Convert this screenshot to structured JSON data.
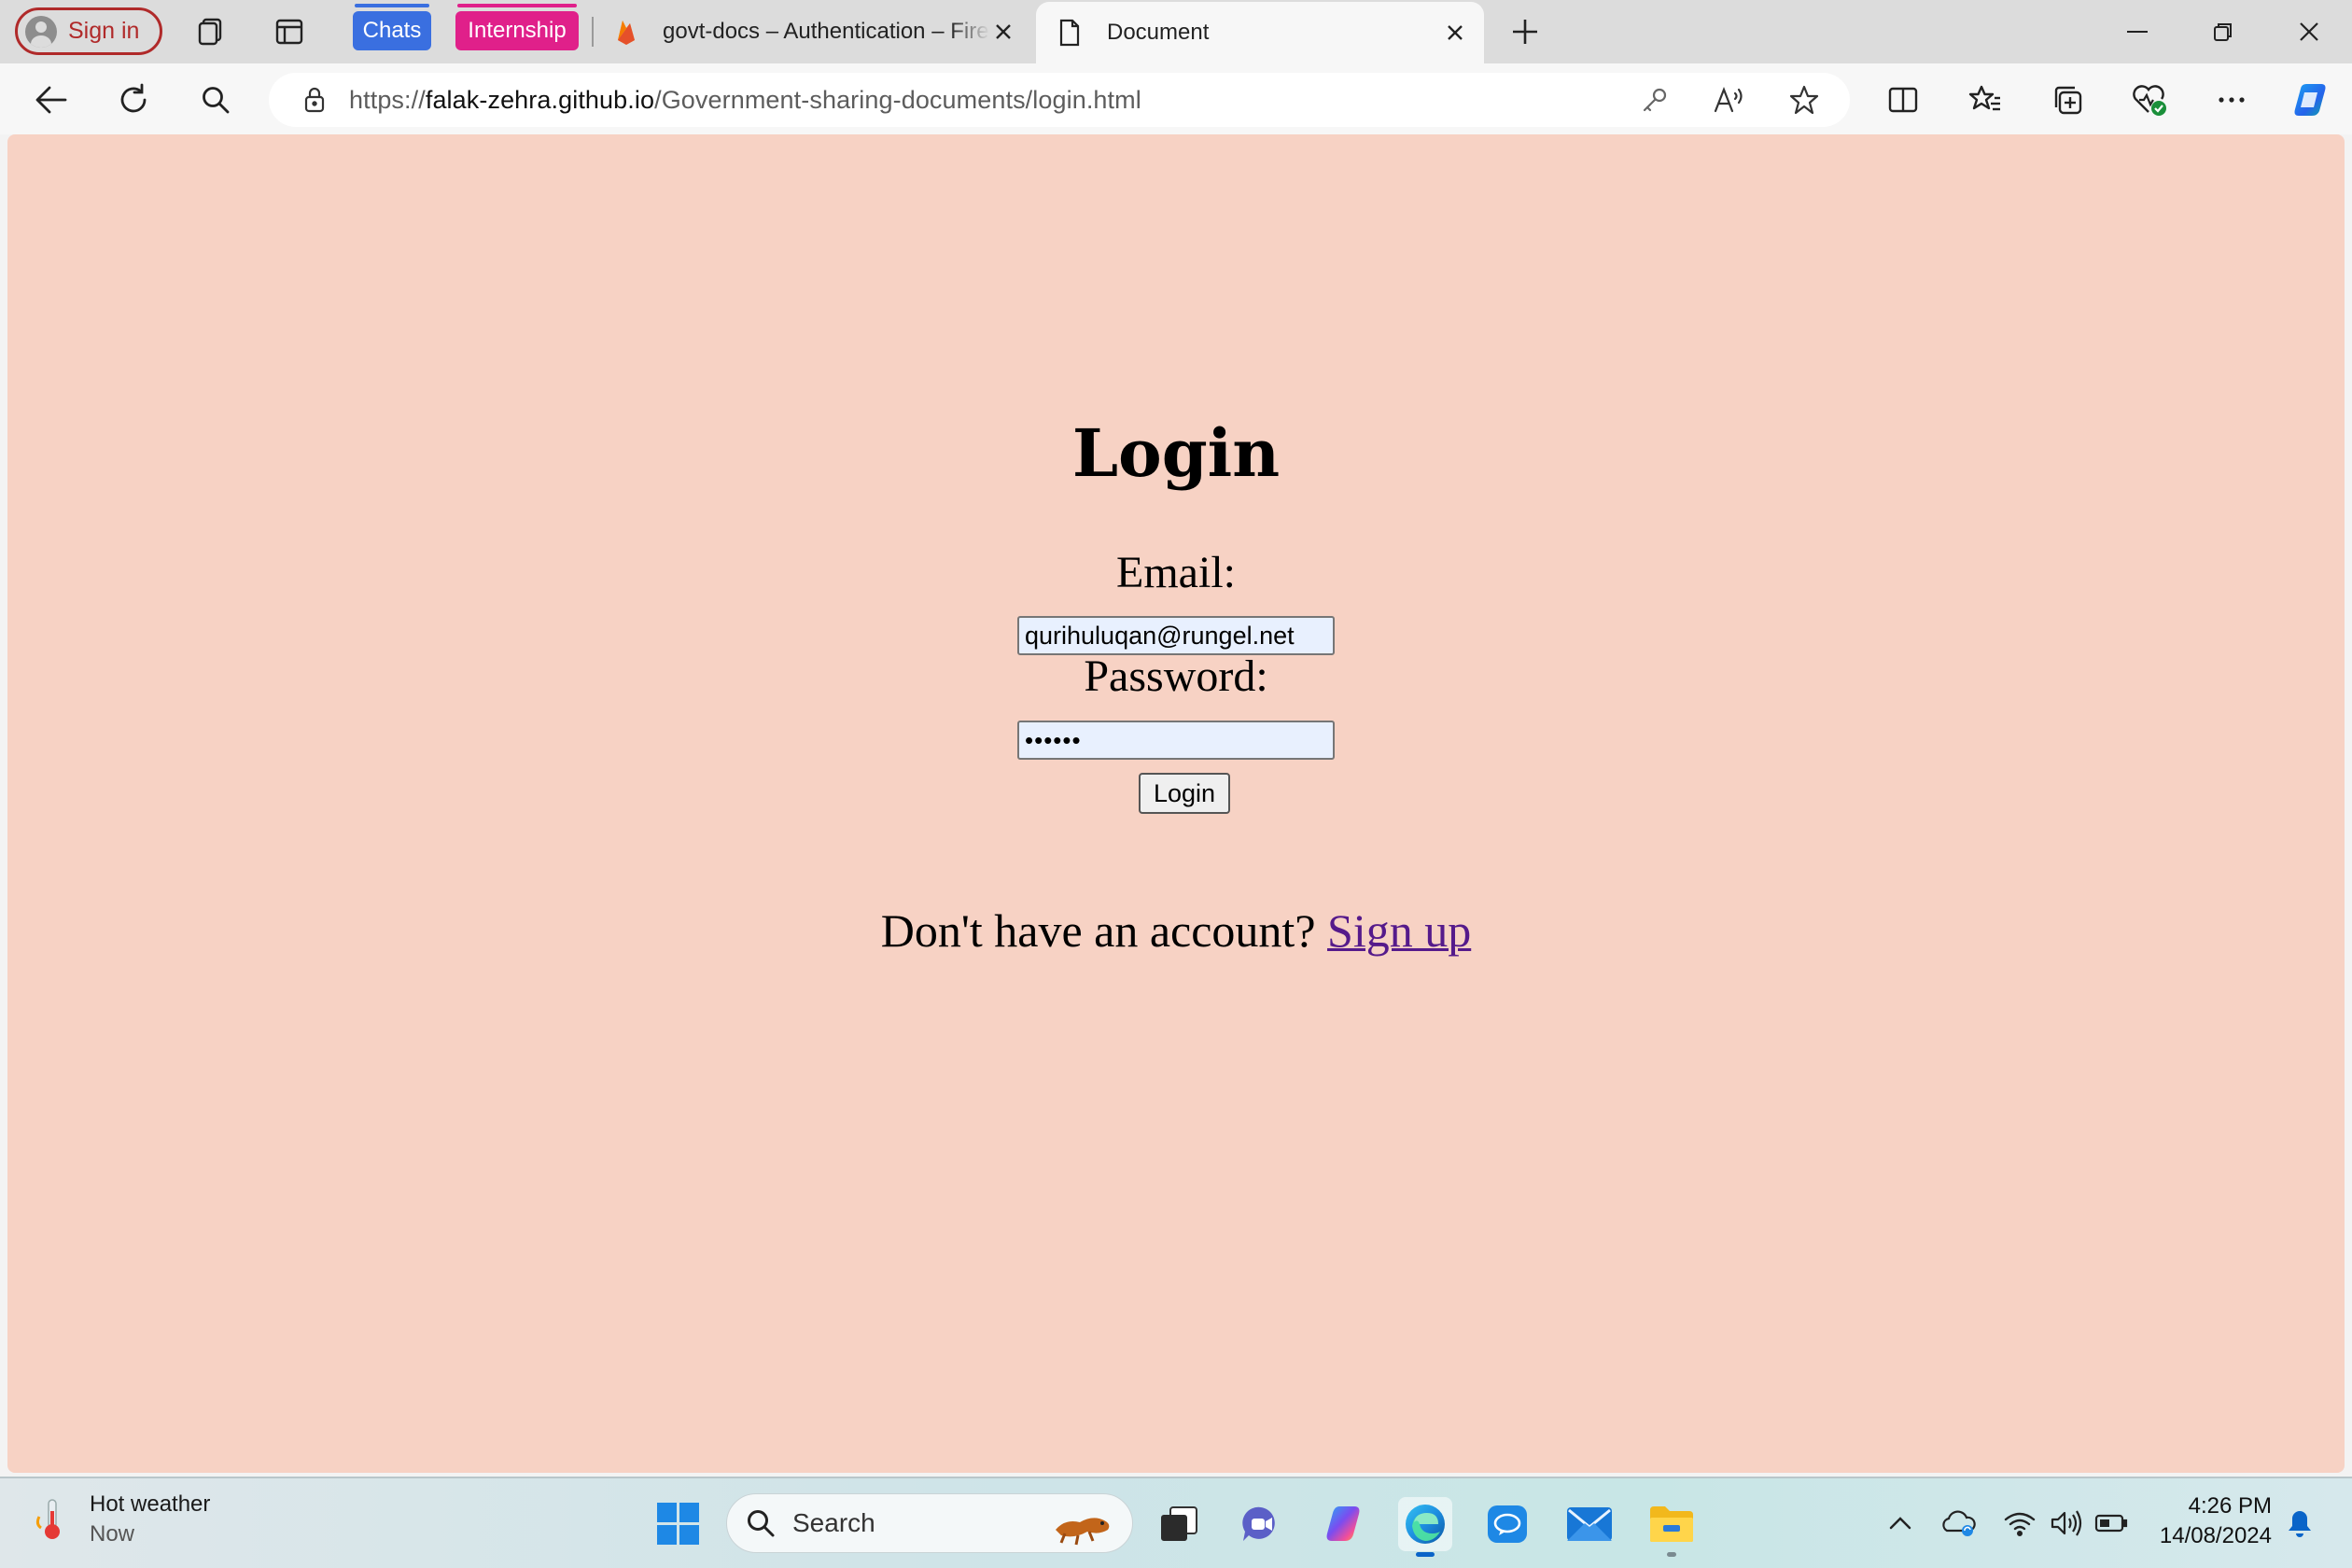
{
  "browser": {
    "profile_button": "Sign in",
    "tab_groups": [
      {
        "label": "Chats",
        "color": "#3a6fe0"
      },
      {
        "label": "Internship",
        "color": "#e0208a"
      }
    ],
    "tabs": [
      {
        "title": "govt-docs – Authentication – Firebase console",
        "icon": "firebase-icon",
        "active": false
      },
      {
        "title": "Document",
        "icon": "document-icon",
        "active": true
      }
    ],
    "url": {
      "scheme": "https://",
      "host": "falak-zehra.github.io",
      "path": "/Government-sharing-documents/login.html"
    }
  },
  "page": {
    "background": "#f7d2c4",
    "heading": "Login",
    "email_label": "Email:",
    "email_value": "qurihuluqan@rungel.net",
    "password_label": "Password:",
    "password_value": "••••••",
    "login_button": "Login",
    "signup_prompt": "Don't have an account?",
    "signup_link": "Sign up"
  },
  "taskbar": {
    "weather_title": "Hot weather",
    "weather_sub": "Now",
    "search_placeholder": "Search",
    "time": "4:26 PM",
    "date": "14/08/2024"
  }
}
